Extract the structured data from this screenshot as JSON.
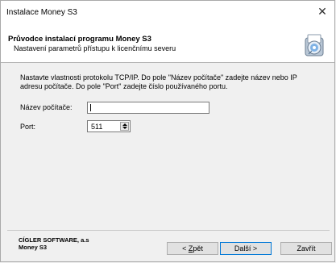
{
  "window": {
    "title": "Instalace Money S3",
    "close_glyph": "✕"
  },
  "header": {
    "title": "Průvodce instalací programu Money S3",
    "subtitle": "Nastavení parametrů přístupu k licenčnímu severu",
    "icon": "cd-installer-icon"
  },
  "body": {
    "description": "Nastavte vlastnosti protokolu TCP/IP. Do pole \"Název počítače\" zadejte název nebo IP adresu počítače. Do pole \"Port\" zadejte číslo používaného portu.",
    "computer_name_label": "Název počítače:",
    "computer_name_value": "",
    "port_label": "Port:",
    "port_value": "511"
  },
  "footer": {
    "company_line1": "CÍGLER SOFTWARE, a.s",
    "company_line2": "Money S3",
    "back_prefix": "< ",
    "back_mnemonic": "Z",
    "back_rest": "pět",
    "next_label": "Další >",
    "cancel_label": "Zavřít"
  }
}
